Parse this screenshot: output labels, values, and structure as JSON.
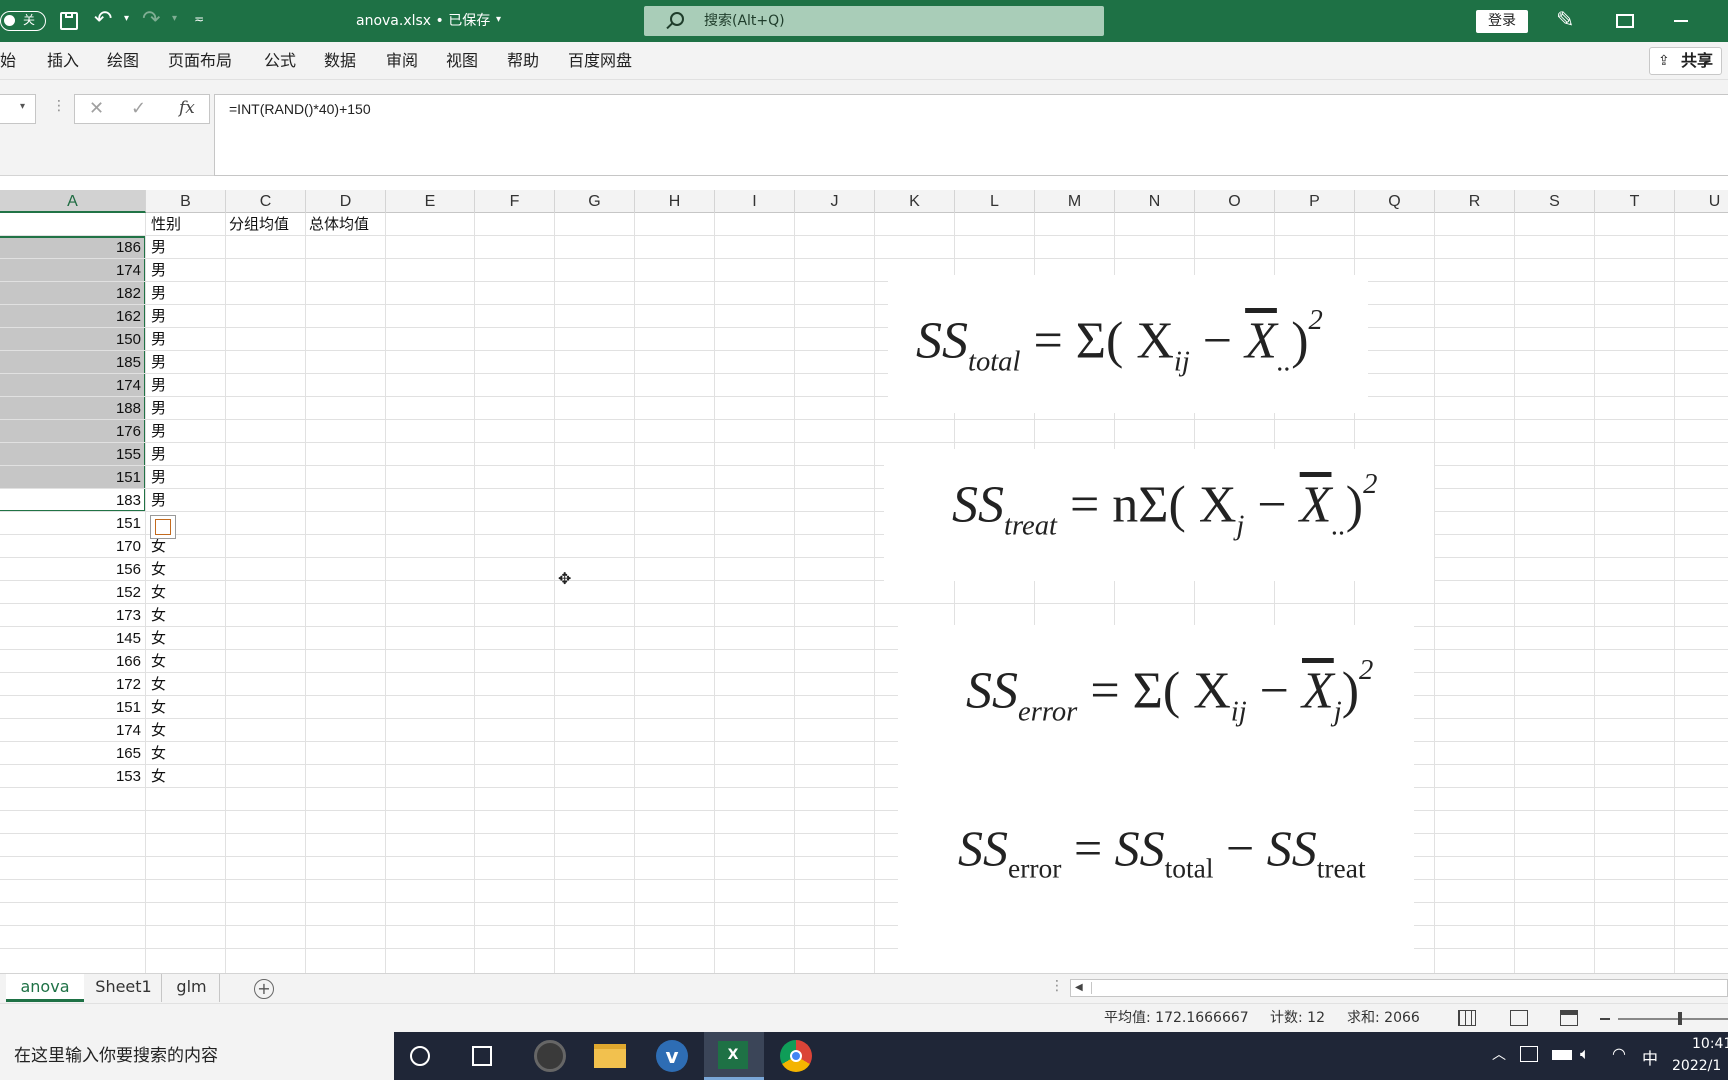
{
  "titlebar": {
    "autosave_toggle": "关",
    "filename": "anova.xlsx • 已保存",
    "search_placeholder": "搜索(Alt+Q)",
    "login": "登录"
  },
  "ribbon": {
    "tabs": [
      "开始",
      "插入",
      "绘图",
      "页面布局",
      "公式",
      "数据",
      "审阅",
      "视图",
      "帮助",
      "百度网盘"
    ],
    "share": "共享"
  },
  "formula_bar": {
    "fx": "fx",
    "formula": "=INT(RAND()*40)+150"
  },
  "columns": [
    "A",
    "B",
    "C",
    "D",
    "E",
    "F",
    "G",
    "H",
    "I",
    "J",
    "K",
    "L",
    "M",
    "N",
    "O",
    "P",
    "Q",
    "R",
    "S",
    "T",
    "U"
  ],
  "header_row": {
    "b": "性别",
    "c": "分组均值",
    "d": "总体均值"
  },
  "rows": [
    {
      "a": "186",
      "b": "男"
    },
    {
      "a": "174",
      "b": "男"
    },
    {
      "a": "182",
      "b": "男"
    },
    {
      "a": "162",
      "b": "男"
    },
    {
      "a": "150",
      "b": "男"
    },
    {
      "a": "185",
      "b": "男"
    },
    {
      "a": "174",
      "b": "男"
    },
    {
      "a": "188",
      "b": "男"
    },
    {
      "a": "176",
      "b": "男"
    },
    {
      "a": "155",
      "b": "男"
    },
    {
      "a": "151",
      "b": "男"
    },
    {
      "a": "183",
      "b": "男"
    },
    {
      "a": "151",
      "b": "女"
    },
    {
      "a": "170",
      "b": "女"
    },
    {
      "a": "156",
      "b": "女"
    },
    {
      "a": "152",
      "b": "女"
    },
    {
      "a": "173",
      "b": "女"
    },
    {
      "a": "145",
      "b": "女"
    },
    {
      "a": "166",
      "b": "女"
    },
    {
      "a": "172",
      "b": "女"
    },
    {
      "a": "151",
      "b": "女"
    },
    {
      "a": "174",
      "b": "女"
    },
    {
      "a": "165",
      "b": "女"
    },
    {
      "a": "153",
      "b": "女"
    }
  ],
  "equations": {
    "ss_total": {
      "lhs": "SS",
      "lhs_sub": "total",
      "rhs_pre": "= Σ( X",
      "rhs_sub1": "ij",
      "minus": " − ",
      "bar": "X",
      "bar_sub": "..",
      "close": ")",
      "sup": "2"
    },
    "ss_treat": {
      "lhs": "SS",
      "lhs_sub": "treat",
      "rhs_pre": "= nΣ( X",
      "rhs_sub1": "j",
      "minus": " − ",
      "bar": "X",
      "bar_sub": "..",
      "close": ")",
      "sup": "2"
    },
    "ss_error": {
      "lhs": "SS",
      "lhs_sub": "error",
      "rhs_pre": "= Σ( X",
      "rhs_sub1": "ij",
      "minus": " − ",
      "bar": "X",
      "bar_sub": "j",
      "close": ")",
      "sup": "2"
    },
    "ss_error2": {
      "lhs": "SS",
      "lhs_sub": "error",
      "eq": " = ",
      "t1": "SS",
      "t1_sub": "total",
      "minus": " − ",
      "t2": "SS",
      "t2_sub": "treat"
    }
  },
  "sheets": [
    "anova",
    "Sheet1",
    "glm"
  ],
  "statusbar": {
    "average": "平均值: 172.1666667",
    "count": "计数: 12",
    "sum": "求和: 2066"
  },
  "taskbar": {
    "search_placeholder": "在这里输入你要搜索的内容",
    "ime": "中",
    "time": "10:41",
    "date": "2022/1"
  },
  "colors": {
    "excel_green": "#1e7145",
    "selection_gray": "#c6c6c6",
    "taskbar": "#1f2637"
  }
}
